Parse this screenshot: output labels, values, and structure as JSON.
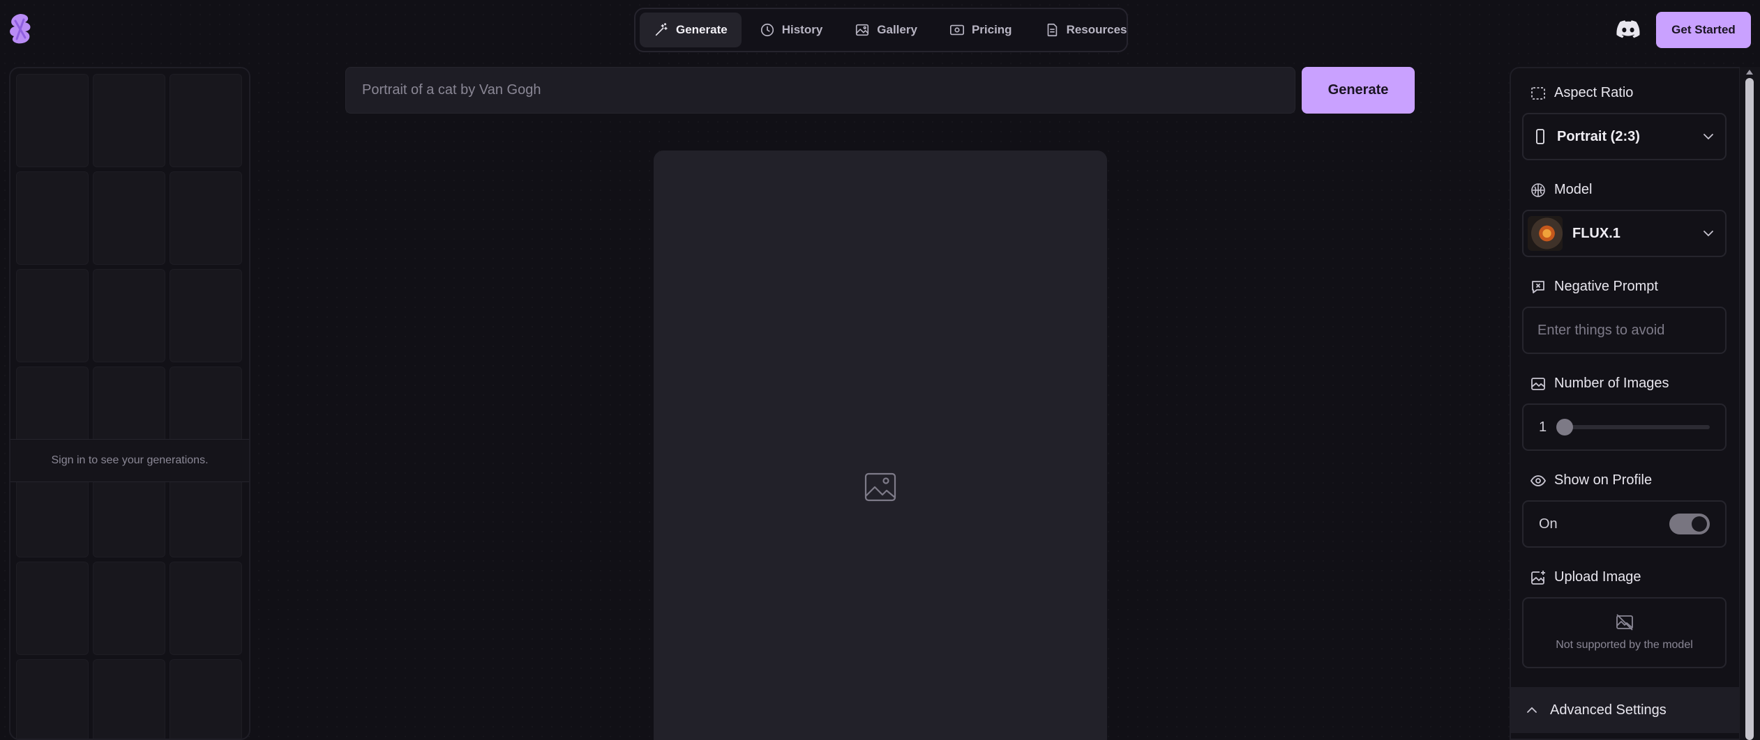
{
  "nav": {
    "items": [
      {
        "label": "Generate",
        "icon": "magic-wand-icon",
        "active": true
      },
      {
        "label": "History",
        "icon": "clock-icon",
        "active": false
      },
      {
        "label": "Gallery",
        "icon": "image-icon",
        "active": false
      },
      {
        "label": "Pricing",
        "icon": "money-icon",
        "active": false
      },
      {
        "label": "Resources",
        "icon": "document-icon",
        "active": false
      }
    ]
  },
  "header": {
    "get_started_label": "Get Started",
    "discord_icon": "discord-icon",
    "logo_icon": "logo-icon"
  },
  "history": {
    "signin_text": "Sign in to see your generations."
  },
  "prompt": {
    "placeholder": "Portrait of a cat by Van Gogh",
    "generate_label": "Generate"
  },
  "settings": {
    "aspect_ratio": {
      "label": "Aspect Ratio",
      "value": "Portrait (2:3)"
    },
    "model": {
      "label": "Model",
      "value": "FLUX.1"
    },
    "negative_prompt": {
      "label": "Negative Prompt",
      "placeholder": "Enter things to avoid"
    },
    "num_images": {
      "label": "Number of Images",
      "value": "1"
    },
    "show_on_profile": {
      "label": "Show on Profile",
      "value": "On",
      "enabled": true
    },
    "upload_image": {
      "label": "Upload Image",
      "note": "Not supported by the model"
    },
    "advanced": {
      "label": "Advanced Settings"
    }
  },
  "colors": {
    "accent": "#c9a1ff",
    "background": "#111016",
    "panel": "#121117"
  }
}
